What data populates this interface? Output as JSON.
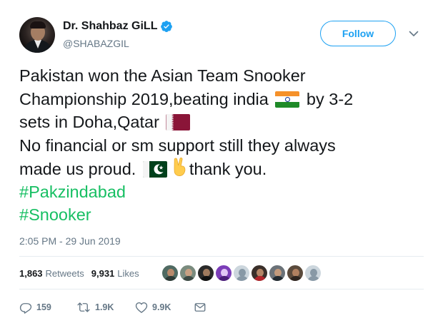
{
  "user": {
    "name": "Dr. Shahbaz GiLL",
    "handle": "@SHABAZGIL",
    "verified": true,
    "follow_label": "Follow"
  },
  "tweet": {
    "line1": "Pakistan won the Asian Team Snooker",
    "line2_pre": "Championship 2019,beating india",
    "line2_post": "by 3-2",
    "line3": "sets in Doha,Qatar",
    "line4": "No financial or sm support still they always",
    "line5_pre": "made us proud.",
    "line5_post": "thank you.",
    "hashtag1": "#Pakzindabad",
    "hashtag2": "#Snooker",
    "timestamp": "2:05 PM - 29 Jun 2019"
  },
  "stats": {
    "retweets_count": "1,863",
    "retweets_label": "Retweets",
    "likes_count": "9,931",
    "likes_label": "Likes"
  },
  "actions": {
    "reply_count": "159",
    "retweet_count": "1.9K",
    "like_count": "9.9K"
  },
  "colors": {
    "accent": "#1da1f2",
    "hashtag": "#17bf63",
    "secondary_text": "#657786",
    "divider": "#e6ecf0"
  }
}
